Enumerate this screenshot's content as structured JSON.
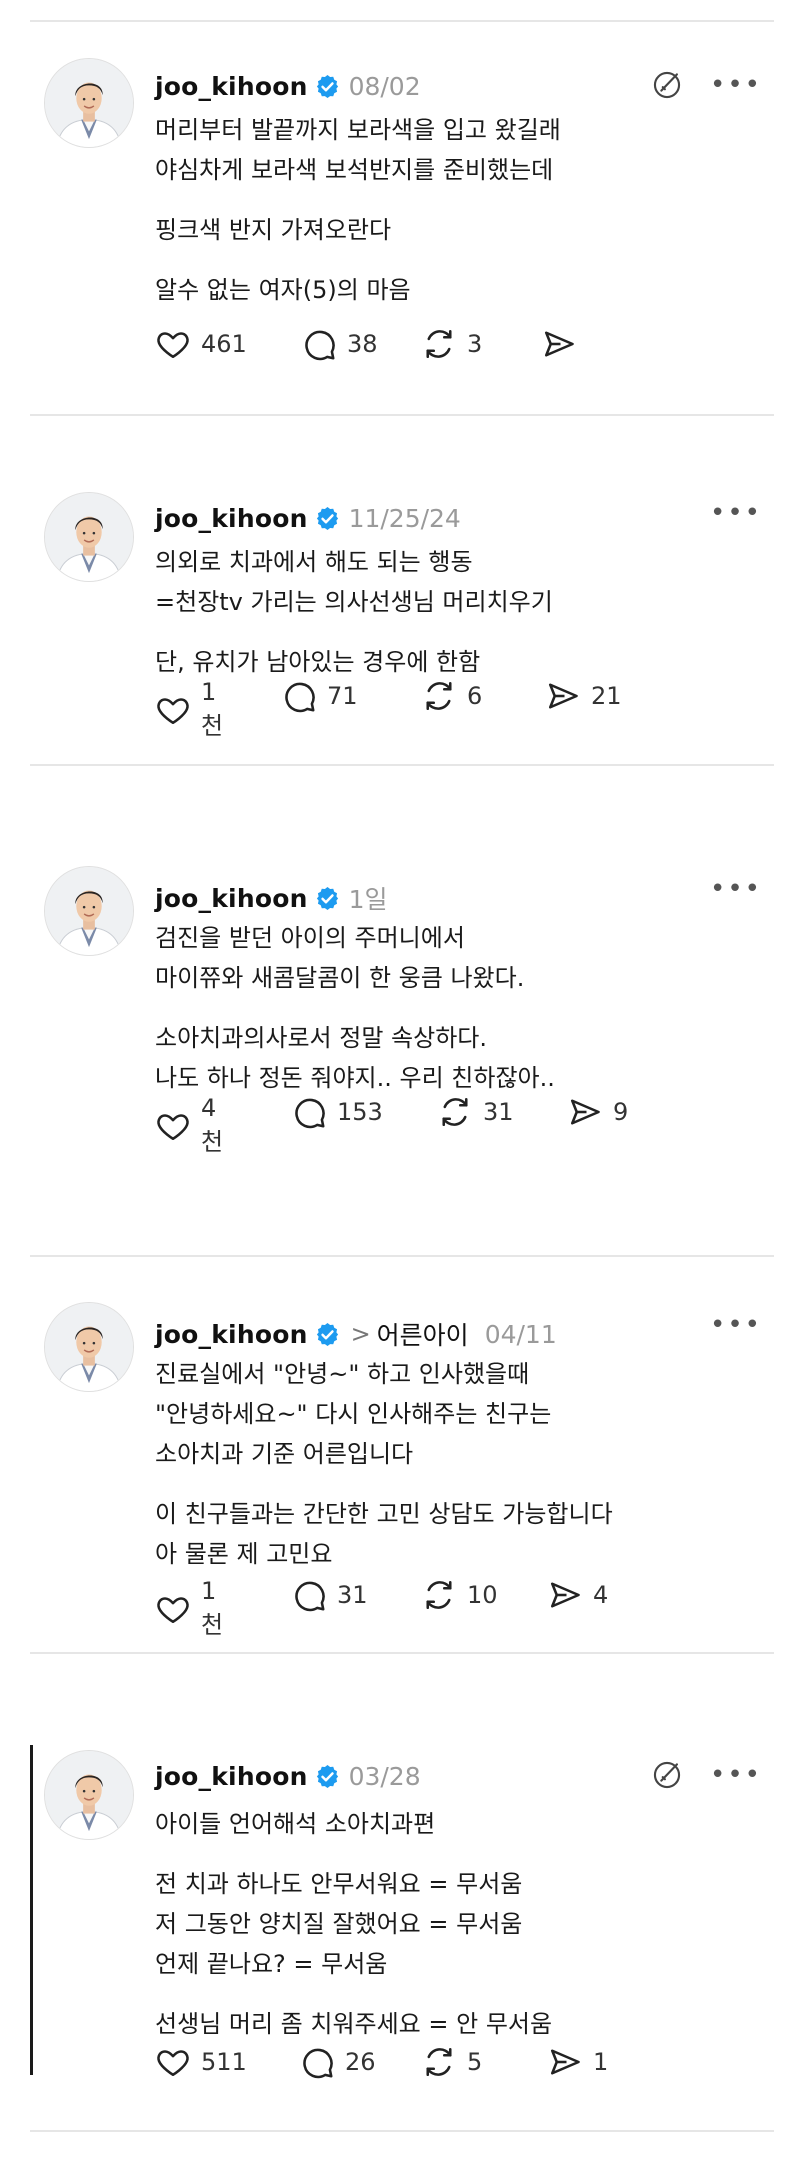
{
  "posts": [
    {
      "username": "joo_kihoon",
      "date": "08/02",
      "topic": "",
      "lines": [
        "머리부터 발끝까지 보라색을 입고 왔길래",
        "야심차게 보라색 보석반지를 준비했는데",
        "",
        "핑크색 반지 가져오란다",
        "",
        "알수 없는 여자(5)의 마음"
      ],
      "likes": "461",
      "replies": "38",
      "reposts": "3",
      "shares": ""
    },
    {
      "username": "joo_kihoon",
      "date": "11/25/24",
      "topic": "",
      "lines": [
        "의외로 치과에서 해도 되는 행동",
        "=천장tv 가리는 의사선생님 머리치우기",
        "",
        "단, 유치가 남아있는 경우에 한함"
      ],
      "likes": "1천",
      "replies": "71",
      "reposts": "6",
      "shares": "21"
    },
    {
      "username": "joo_kihoon",
      "date": "1일",
      "topic": "",
      "lines": [
        "검진을 받던 아이의 주머니에서",
        "마이쮸와 새콤달콤이 한 웅큼 나왔다.",
        "",
        "소아치과의사로서 정말 속상하다.",
        "나도 하나 정돈 줘야지.. 우리 친하잖아.."
      ],
      "likes": "4천",
      "replies": "153",
      "reposts": "31",
      "shares": "9"
    },
    {
      "username": "joo_kihoon",
      "date": "04/11",
      "topic": "어른아이",
      "lines": [
        "진료실에서 \"안녕~\" 하고 인사했을때",
        "\"안녕하세요~\" 다시 인사해주는 친구는",
        "소아치과 기준 어른입니다",
        "",
        "이 친구들과는 간단한 고민 상담도 가능합니다",
        "아 물론 제 고민요"
      ],
      "likes": "1천",
      "replies": "31",
      "reposts": "10",
      "shares": "4"
    },
    {
      "username": "joo_kihoon",
      "date": "03/28",
      "topic": "",
      "lines": [
        "아이들 언어해석 소아치과편",
        "",
        "전 치과 하나도 안무서워요 = 무서움",
        "저 그동안 양치질 잘했어요 = 무서움",
        "언제 끝나요? = 무서움",
        "",
        "선생님 머리 좀 치워주세요 = 안 무서움"
      ],
      "likes": "511",
      "replies": "26",
      "reposts": "5",
      "shares": "1"
    }
  ],
  "icons": {
    "verified_color": "#1d9bf0",
    "like": "heart-icon",
    "reply": "comment-icon",
    "repost": "repost-icon",
    "share": "send-icon",
    "more": "more-icon",
    "mute": "mute-icon"
  }
}
